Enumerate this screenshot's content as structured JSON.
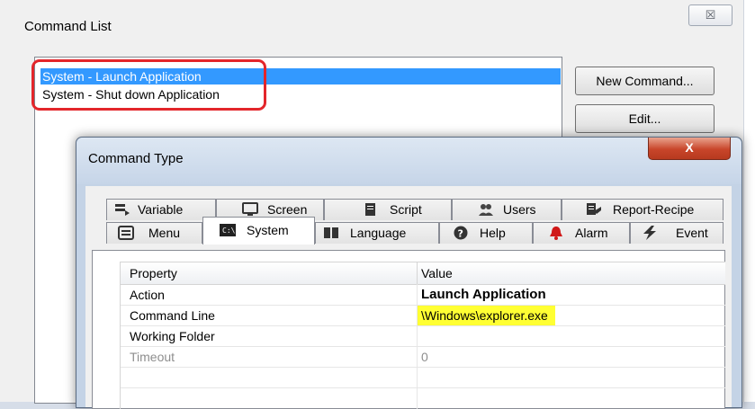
{
  "command_list": {
    "title": "Command List",
    "close_label": "☒",
    "items": [
      "System - Launch Application",
      "System - Shut down Application"
    ],
    "buttons": {
      "new_command": "New Command...",
      "edit": "Edit..."
    }
  },
  "command_type": {
    "title": "Command Type",
    "close_label": "X",
    "tabs_row1": [
      {
        "label": "Variable",
        "icon": "variable-icon"
      },
      {
        "label": "Screen",
        "icon": "screen-icon"
      },
      {
        "label": "Script",
        "icon": "script-icon"
      },
      {
        "label": "Users",
        "icon": "users-icon"
      },
      {
        "label": "Report-Recipe",
        "icon": "report-recipe-icon"
      }
    ],
    "tabs_row2": [
      {
        "label": "Menu",
        "icon": "menu-icon"
      },
      {
        "label": "System",
        "icon": "system-icon",
        "active": true
      },
      {
        "label": "Language",
        "icon": "language-icon"
      },
      {
        "label": "Help",
        "icon": "help-icon"
      },
      {
        "label": "Alarm",
        "icon": "alarm-icon"
      },
      {
        "label": "Event",
        "icon": "event-icon"
      }
    ],
    "grid": {
      "headers": {
        "property": "Property",
        "value": "Value"
      },
      "rows": [
        {
          "property": "Action",
          "value": "Launch Application"
        },
        {
          "property": "Command Line",
          "value": "\\Windows\\explorer.exe"
        },
        {
          "property": "Working Folder",
          "value": ""
        },
        {
          "property": "Timeout",
          "value": "0"
        }
      ]
    }
  },
  "colors": {
    "selection": "#3399ff",
    "highlight_border": "#e3262b",
    "value_highlight": "#ffff33",
    "close_button": "#c8452a"
  }
}
